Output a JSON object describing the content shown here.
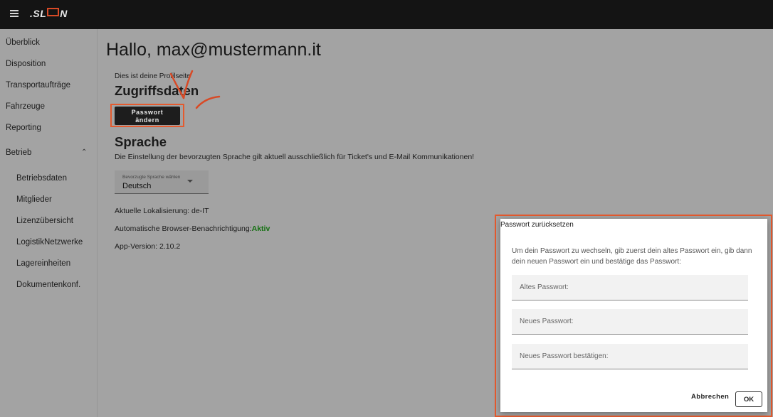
{
  "app": {
    "logo_text_left": "SL",
    "logo_text_right": "N"
  },
  "sidebar": {
    "items": [
      {
        "label": "Überblick"
      },
      {
        "label": "Disposition"
      },
      {
        "label": "Transportaufträge"
      },
      {
        "label": "Fahrzeuge"
      },
      {
        "label": "Reporting"
      },
      {
        "label": "Betrieb"
      }
    ],
    "sub_items": [
      {
        "label": "Betriebsdaten"
      },
      {
        "label": "Mitglieder"
      },
      {
        "label": "Lizenzübersicht"
      },
      {
        "label": "LogistikNetzwerke"
      },
      {
        "label": "Lagereinheiten"
      },
      {
        "label": "Dokumentenkonf."
      }
    ]
  },
  "main": {
    "greeting": "Hallo, max@mustermann.it",
    "profile_note": "Dies ist deine Profilseite",
    "access_heading": "Zugriffsdaten",
    "change_password_line1": "Passwort",
    "change_password_line2": "ändern",
    "language_heading": "Sprache",
    "language_note": "Die Einstellung der bevorzugten Sprache gilt aktuell ausschließlich für Ticket's und E-Mail Kommunikationen!",
    "language_select_label": "Bevorzugte Sprache wählen",
    "language_select_value": "Deutsch",
    "localization": "Aktuelle Lokalisierung: de-IT",
    "notification_label": "Automatische Browser-Benachrichtigung:",
    "notification_value": "Aktiv",
    "app_version": "App-Version: 2.10.2"
  },
  "dialog": {
    "title": "Passwort zurücksetzen",
    "text": "Um dein Passwort zu wechseln, gib zuerst dein altes Passwort ein, gib dann dein neuen Passwort ein und bestätige das Passwort:",
    "old_password_placeholder": "Altes Passwort:",
    "new_password_placeholder": "Neues Passwort:",
    "confirm_password_placeholder": "Neues Passwort bestätigen:",
    "cancel_label": "Abbrechen",
    "ok_label": "OK"
  },
  "colors": {
    "accent": "#e45a2e",
    "active_status": "#12700f"
  }
}
